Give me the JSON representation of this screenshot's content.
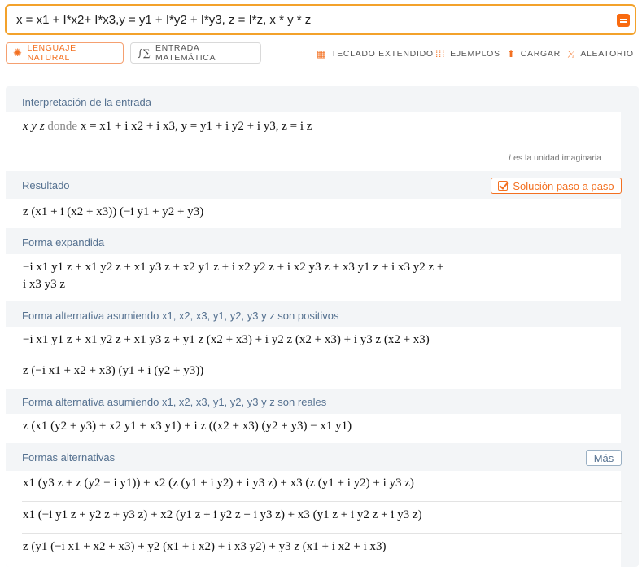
{
  "search": {
    "query": "x = x1 + I*x2+ I*x3,y = y1 + I*y2 + I*y3, z = I*z, x * y * z",
    "submit_icon": "equals-icon"
  },
  "modes": {
    "natural_label": "LENGUAJE NATURAL",
    "math_label": "ENTRADA MATEMÁTICA"
  },
  "toolbar": {
    "keyboard_label": "TECLADO EXTENDIDO",
    "examples_label": "EJEMPLOS",
    "upload_label": "CARGAR",
    "random_label": "ALEATORIO"
  },
  "pods": {
    "input": {
      "title": "Interpretación de la entrada",
      "prefix": "x y z",
      "where": "donde",
      "definition": "x = x1 + i x2 + i x3, y = y1 + i y2 + i y3, z = i z",
      "note_symbol": "i",
      "note": "es la unidad imaginaria"
    },
    "result": {
      "title": "Resultado",
      "step_button": "Solución paso a paso",
      "expr": "z (x1 + i (x2 + x3)) (−i y1 + y2 + y3)"
    },
    "expanded": {
      "title": "Forma expandida",
      "line1": "−i x1 y1 z + x1 y2 z + x1 y3 z + x2 y1 z + i x2 y2 z + i x2 y3 z + x3 y1 z + i x3 y2 z +",
      "line2": "i x3 y3 z"
    },
    "alt_positive": {
      "title": "Forma alternativa asumiendo x1, x2, x3, y1, y2, y3 y z son positivos",
      "expr1": "−i x1 y1 z + x1 y2 z + x1 y3 z + y1 z (x2 + x3) + i y2 z (x2 + x3) + i y3 z (x2 + x3)",
      "expr2": "z (−i x1 + x2 + x3) (y1 + i (y2 + y3))"
    },
    "alt_real": {
      "title": "Forma alternativa asumiendo x1, x2, x3, y1, y2, y3 y z son reales",
      "expr": "z (x1 (y2 + y3) + x2 y1 + x3 y1) + i z ((x2 + x3) (y2 + y3) − x1 y1)"
    },
    "alternatives": {
      "title": "Formas alternativas",
      "more_button": "Más",
      "items": [
        "x1 (y3 z + z (y2 − i y1)) + x2 (z (y1 + i y2) + i y3 z) + x3 (z (y1 + i y2) + i y3 z)",
        "x1 (−i y1 z + y2 z + y3 z) + x2 (y1 z + i y2 z + i y3 z) + x3 (y1 z + i y2 z + i y3 z)",
        "z (y1 (−i x1 + x2 + x3) + y2 (x1 + i x2) + i x3 y2) + y3 z (x1 + i x2 + i x3)"
      ]
    }
  }
}
